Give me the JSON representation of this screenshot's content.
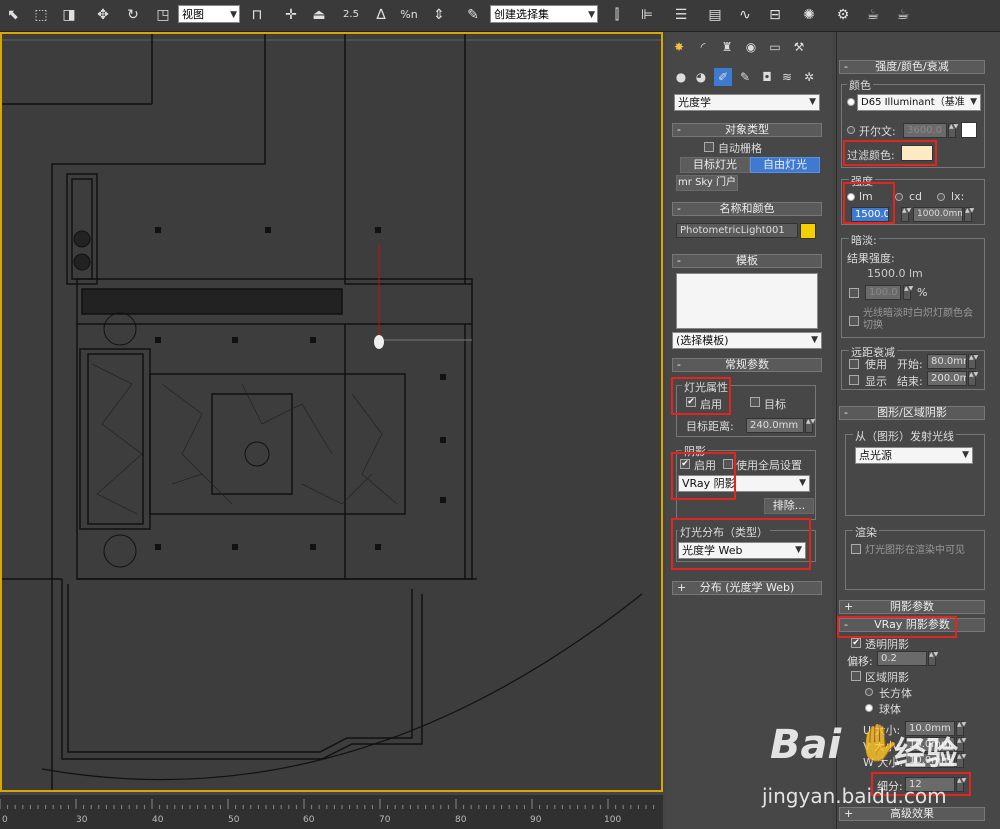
{
  "toolbar": {
    "view_dropdown": "视图",
    "selection_set": "创建选择集",
    "snap_angle_label": "2.5",
    "percent_label": "%n"
  },
  "command_panel": {
    "category_dropdown": "光度学",
    "object_type": {
      "title": "对象类型",
      "auto_grid": "自动栅格",
      "target_light": "目标灯光",
      "free_light": "自由灯光",
      "mr_sky_portal": "mr Sky 门户"
    },
    "name_color": {
      "title": "名称和颜色",
      "name_value": "PhotometricLight001",
      "color": "#f5d000"
    },
    "templates": {
      "title": "模板",
      "dropdown": "(选择模板)"
    },
    "general": {
      "title": "常规参数",
      "light_props": "灯光属性",
      "enabled": "启用",
      "target": "目标",
      "target_distance_label": "目标距离:",
      "target_distance": "240.0mm",
      "shadows": "阴影",
      "shadows_enabled": "启用",
      "use_global": "使用全局设置",
      "shadow_type": "VRay 阴影",
      "exclude": "排除..."
    },
    "distribution": {
      "title": "灯光分布（类型）",
      "value": "光度学 Web"
    },
    "distribution_web": "分布 (光度学 Web)"
  },
  "right_panel": {
    "intensity_rollout": "强度/颜色/衰减",
    "color_group": "颜色",
    "preset": "D65 Illuminant（基准",
    "kelvin_label": "开尔文:",
    "kelvin_value": "3600.0",
    "filter_color_label": "过滤颜色:",
    "filter_color": "#fde9c2",
    "intensity_group": "强度",
    "lm": "lm",
    "cd": "cd",
    "lx": "lx:",
    "lm_value": "1500.0",
    "lx_value": "1000.0mm",
    "dimming_group": "暗淡:",
    "result_label": "结果强度:",
    "result_value": "1500.0 lm",
    "dim_percent": "100.0",
    "percent": "%",
    "dim_incandescent": "光线暗淡时白炽灯颜色会切换",
    "far_atten": "远距衰减",
    "use": "使用",
    "start": "开始:",
    "start_value": "80.0mm",
    "show": "显示",
    "end": "结束:",
    "end_value": "200.0mm",
    "shape_rollout": "图形/区域阴影",
    "emit_from": "从（图形）发射光线",
    "shape_type": "点光源",
    "render_group": "渲染",
    "visible_in_render": "灯光图形在渲染中可见",
    "shadow_params": "阴影参数",
    "vray_shadow_params": "VRay 阴影参数",
    "transparent_shadows": "透明阴影",
    "bias_label": "偏移:",
    "bias_value": "0.2",
    "area_shadow": "区域阴影",
    "box": "长方体",
    "sphere": "球体",
    "u_size_label": "U 大小:",
    "u_size": "10.0mm",
    "v_size_label": "V 大小:",
    "v_size": "10.0mm",
    "w_size_label": "W 大小:",
    "w_size": "10.0mm",
    "subdivs_label": "细分:",
    "subdivs": "12",
    "advanced": "高级效果"
  },
  "ruler": {
    "ticks": [
      "0",
      "30",
      "40",
      "50",
      "60",
      "70",
      "80",
      "90",
      "100"
    ]
  },
  "watermark": {
    "brand": "Bai",
    "brand_cn": "经验",
    "url": "jingyan.baidu.com"
  }
}
